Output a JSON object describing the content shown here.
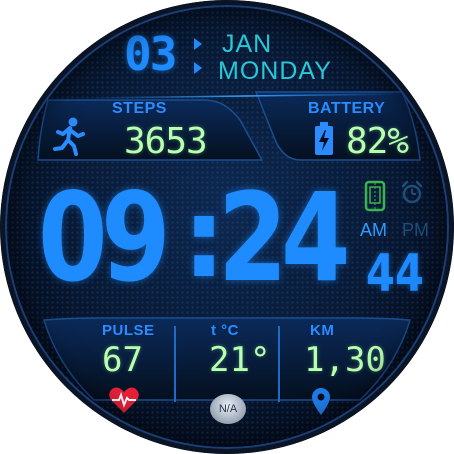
{
  "date": {
    "day": "03",
    "month": "JAN",
    "weekday": "MONDAY"
  },
  "steps": {
    "label": "STEPS",
    "value": "3653"
  },
  "battery": {
    "label": "BATTERY",
    "value": "82%"
  },
  "time": {
    "hours": "09",
    "separator": ":",
    "minutes": "24",
    "seconds": "44",
    "am": "AM",
    "pm": "PM"
  },
  "pulse": {
    "label": "PULSE",
    "value": "67"
  },
  "temperature": {
    "label": "t °C",
    "value": "21°",
    "condition": "N/A"
  },
  "distance": {
    "label": "KM",
    "value": "1,30"
  },
  "colors": {
    "accent": "#1e8cff",
    "value": "#b8ffb0",
    "date_text": "#27c8d8",
    "heart": "#e8203a",
    "battery_icon": "#2a8cff",
    "am_active": "#2a9cff",
    "pm_inactive": "#1d4f7a",
    "phone_icon": "#3cb44b"
  }
}
